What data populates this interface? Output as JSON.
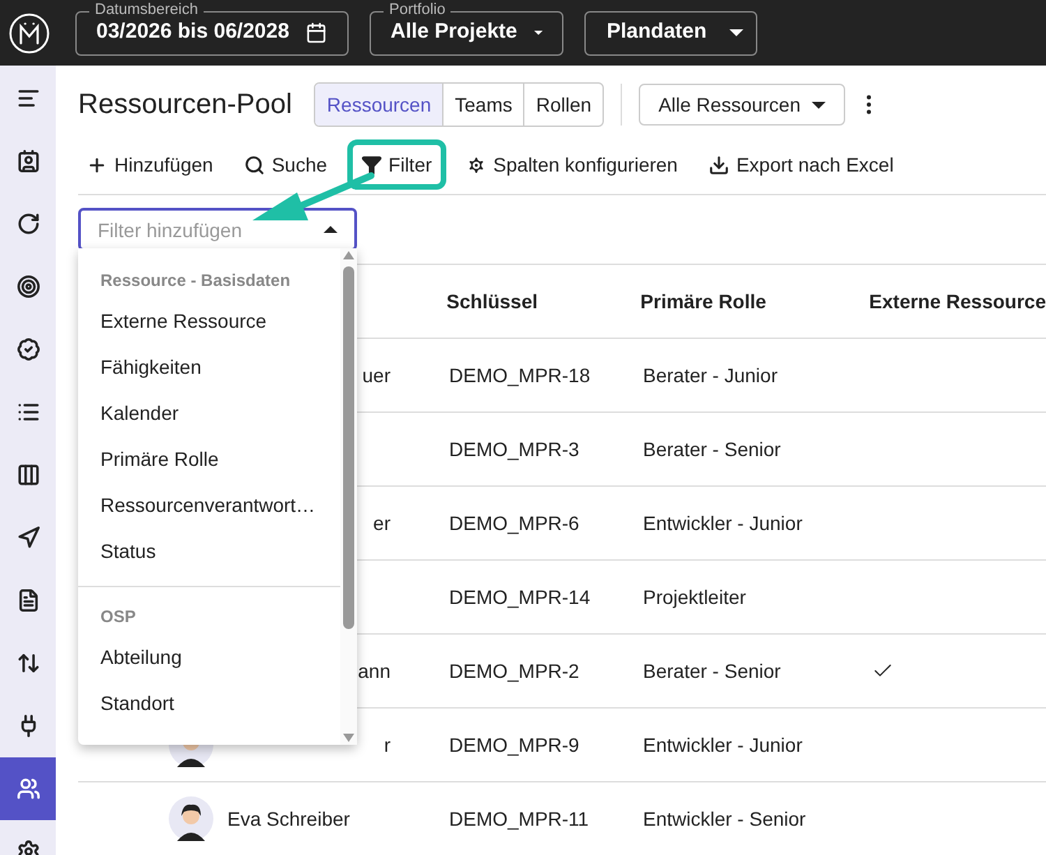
{
  "top_bar": {
    "date_range": {
      "label": "Datumsbereich",
      "value": "03/2026 bis 06/2028"
    },
    "portfolio": {
      "label": "Portfolio",
      "value": "Alle Projekte"
    },
    "plan": {
      "value": "Plandaten"
    }
  },
  "sidebar": {
    "items": [
      {
        "selected": false
      },
      {
        "selected": false
      },
      {
        "selected": false
      },
      {
        "selected": false
      },
      {
        "selected": false
      },
      {
        "selected": false
      },
      {
        "selected": false
      },
      {
        "selected": false
      },
      {
        "selected": false
      },
      {
        "selected": false
      },
      {
        "selected": false
      },
      {
        "selected": true
      },
      {
        "selected": false
      }
    ]
  },
  "page": {
    "title": "Ressourcen-Pool",
    "tabs": [
      {
        "label": "Ressourcen",
        "selected": true
      },
      {
        "label": "Teams",
        "selected": false
      },
      {
        "label": "Rollen",
        "selected": false
      }
    ],
    "view_select": "Alle Ressourcen"
  },
  "toolbar": [
    {
      "kind": "add",
      "label": "Hinzufügen",
      "highlighted": false
    },
    {
      "kind": "search",
      "label": "Suche",
      "highlighted": false
    },
    {
      "kind": "filter",
      "label": "Filter",
      "highlighted": true
    },
    {
      "kind": "columns",
      "label": "Spalten konfigurieren",
      "highlighted": false
    },
    {
      "kind": "export",
      "label": "Export nach Excel",
      "highlighted": false
    }
  ],
  "filter_field": {
    "placeholder": "Filter hinzufügen"
  },
  "filter_menu": {
    "groups": [
      {
        "header": "Ressource - Basisdaten",
        "items": [
          "Externe Ressource",
          "Fähigkeiten",
          "Kalender",
          "Primäre Rolle",
          "Ressourcenverantwort…",
          "Status"
        ]
      },
      {
        "header": "OSP",
        "items": [
          "Abteilung",
          "Standort"
        ]
      }
    ]
  },
  "table": {
    "columns": [
      "Schlüssel",
      "Primäre Rolle",
      "Externe Ressource"
    ],
    "rows": [
      {
        "name": "uer",
        "key": "DEMO_MPR-18",
        "role": "Berater - Junior",
        "external": false,
        "avatar": false
      },
      {
        "key": "DEMO_MPR-3",
        "role": "Berater - Senior",
        "external": false,
        "avatar": false
      },
      {
        "name": "er",
        "key": "DEMO_MPR-6",
        "role": "Entwickler - Junior",
        "external": false,
        "avatar": false
      },
      {
        "key": "DEMO_MPR-14",
        "role": "Projektleiter",
        "external": false,
        "avatar": false
      },
      {
        "name": "ann",
        "key": "DEMO_MPR-2",
        "role": "Berater - Senior",
        "external": true,
        "avatar": false
      },
      {
        "name": "r",
        "key": "DEMO_MPR-9",
        "role": "Entwickler - Junior",
        "external": false,
        "avatar": true
      },
      {
        "name": "Eva Schreiber",
        "key": "DEMO_MPR-11",
        "role": "Entwickler - Senior",
        "external": false,
        "avatar": true
      }
    ]
  }
}
